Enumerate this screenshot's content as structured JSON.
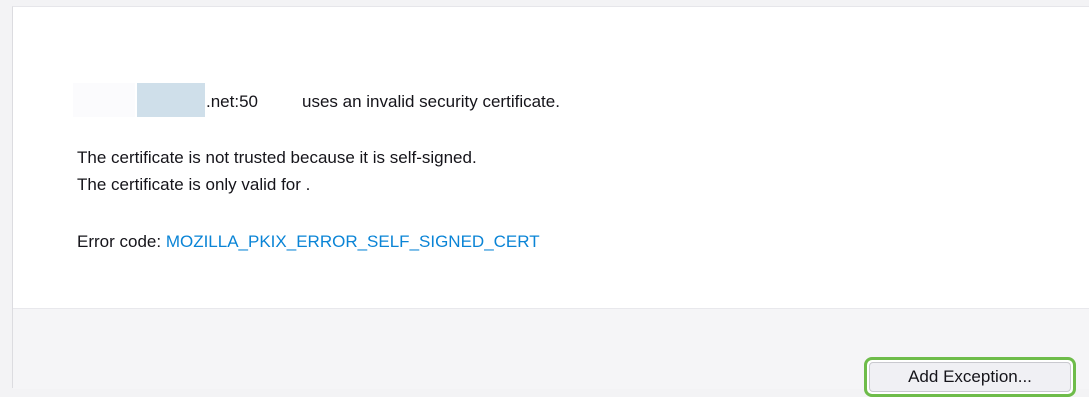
{
  "certificate_error": {
    "host_suffix": ".net:50",
    "host_message": "uses an invalid security certificate.",
    "detail_line_1": "The certificate is not trusted because it is self-signed.",
    "detail_line_2": "The certificate is only valid for .",
    "error_label": "Error code: ",
    "error_code": "MOZILLA_PKIX_ERROR_SELF_SIGNED_CERT"
  },
  "actions": {
    "add_exception_label": "Add Exception..."
  },
  "colors": {
    "link": "#0a84d6",
    "highlight_border": "#6ebc4a",
    "redaction": "#cfdfea"
  }
}
